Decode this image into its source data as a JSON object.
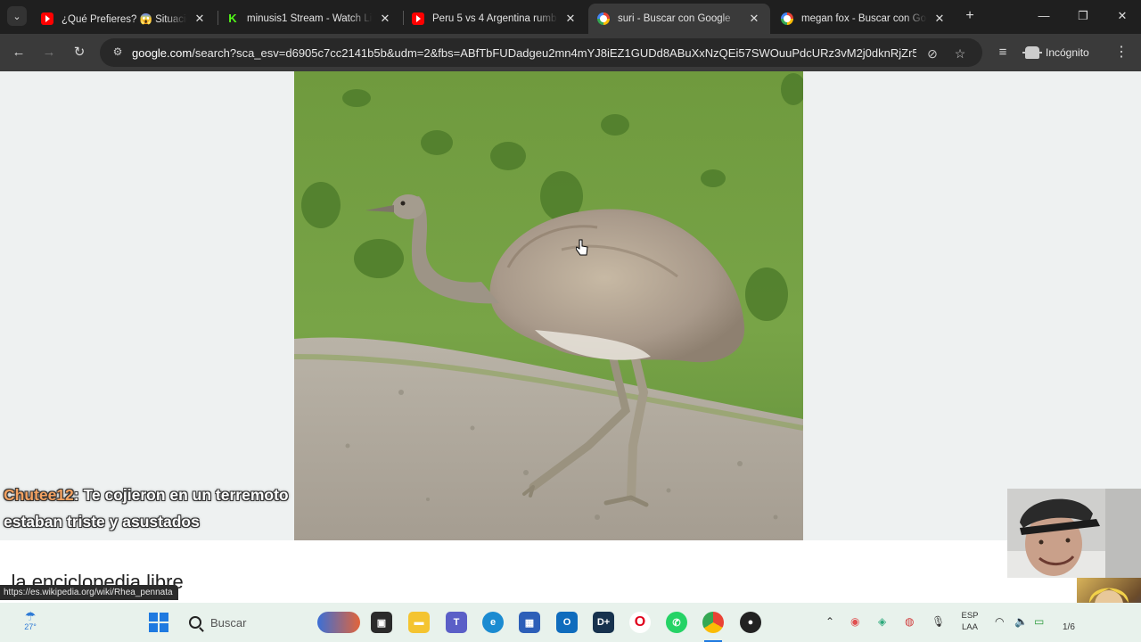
{
  "tabs": [
    {
      "title": "¿Qué Prefieres? 😱 Situacio",
      "favicon": "youtube-icon",
      "active": false
    },
    {
      "title": "minusis1 Stream - Watch Liv",
      "favicon": "kick-icon",
      "active": false
    },
    {
      "title": "Peru 5 vs 4 Argentina rumb",
      "favicon": "youtube-icon",
      "active": false
    },
    {
      "title": "suri - Buscar con Google",
      "favicon": "google-icon",
      "active": true
    },
    {
      "title": "megan fox - Buscar con Goo",
      "favicon": "google-icon",
      "active": false
    }
  ],
  "toolbar": {
    "url_host": "google.com",
    "url_rest": "/search?sca_esv=d6905c7cc2141b5b&udm=2&fbs=ABfTbFUDadgeu2mn4mYJ8iEZ1GUDd8ABuXxNzQEi57SWOuuPdcURz3vM2j0dknRjZr5t...",
    "incognito_label": "Incógnito"
  },
  "content": {
    "wiki_text": "a, la enciclopedia libre",
    "status_url": "https://es.wikipedia.org/wiki/Rhea_pennata"
  },
  "chat": {
    "username": "Chutee12",
    "message": ": Te cojieron en un terremoto estaban triste y asustados"
  },
  "taskbar": {
    "temperature": "27°",
    "search_placeholder": "Buscar",
    "lang_line1": "ESP",
    "lang_line2": "LAA",
    "clock_fragment": "1/6"
  },
  "colors": {
    "chat_username": "#f4a261",
    "tab_strip": "#1f1f1f",
    "toolbar": "#3a3a3a"
  }
}
